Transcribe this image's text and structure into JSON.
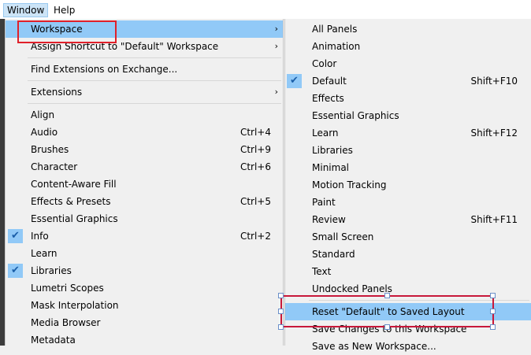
{
  "menubar": {
    "window_label": "Window",
    "help_label": "Help"
  },
  "window_menu": {
    "items": [
      {
        "label": "Workspace",
        "submenu": true,
        "highlighted": true
      },
      {
        "label": "Assign Shortcut to \"Default\" Workspace",
        "submenu": true
      },
      {
        "label": "Find Extensions on Exchange..."
      },
      {
        "label": "Extensions",
        "submenu": true
      },
      {
        "label": "Align"
      },
      {
        "label": "Audio",
        "shortcut": "Ctrl+4"
      },
      {
        "label": "Brushes",
        "shortcut": "Ctrl+9"
      },
      {
        "label": "Character",
        "shortcut": "Ctrl+6"
      },
      {
        "label": "Content-Aware Fill"
      },
      {
        "label": "Effects & Presets",
        "shortcut": "Ctrl+5"
      },
      {
        "label": "Essential Graphics"
      },
      {
        "label": "Info",
        "shortcut": "Ctrl+2",
        "checked": true
      },
      {
        "label": "Learn"
      },
      {
        "label": "Libraries",
        "checked": true
      },
      {
        "label": "Lumetri Scopes"
      },
      {
        "label": "Mask Interpolation"
      },
      {
        "label": "Media Browser"
      },
      {
        "label": "Metadata"
      }
    ]
  },
  "workspace_menu": {
    "items": [
      {
        "label": "All Panels"
      },
      {
        "label": "Animation"
      },
      {
        "label": "Color"
      },
      {
        "label": "Default",
        "shortcut": "Shift+F10",
        "checked": true
      },
      {
        "label": "Effects"
      },
      {
        "label": "Essential Graphics"
      },
      {
        "label": "Learn",
        "shortcut": "Shift+F12"
      },
      {
        "label": "Libraries"
      },
      {
        "label": "Minimal"
      },
      {
        "label": "Motion Tracking"
      },
      {
        "label": "Paint"
      },
      {
        "label": "Review",
        "shortcut": "Shift+F11"
      },
      {
        "label": "Small Screen"
      },
      {
        "label": "Standard"
      },
      {
        "label": "Text"
      },
      {
        "label": "Undocked Panels"
      },
      {
        "label": "Reset \"Default\" to Saved Layout",
        "highlighted": true
      },
      {
        "label": "Save Changes to this Workspace"
      },
      {
        "label": "Save as New Workspace..."
      }
    ]
  },
  "icons": {
    "check": "checkmark-icon",
    "arrow": "chevron-right-icon"
  }
}
